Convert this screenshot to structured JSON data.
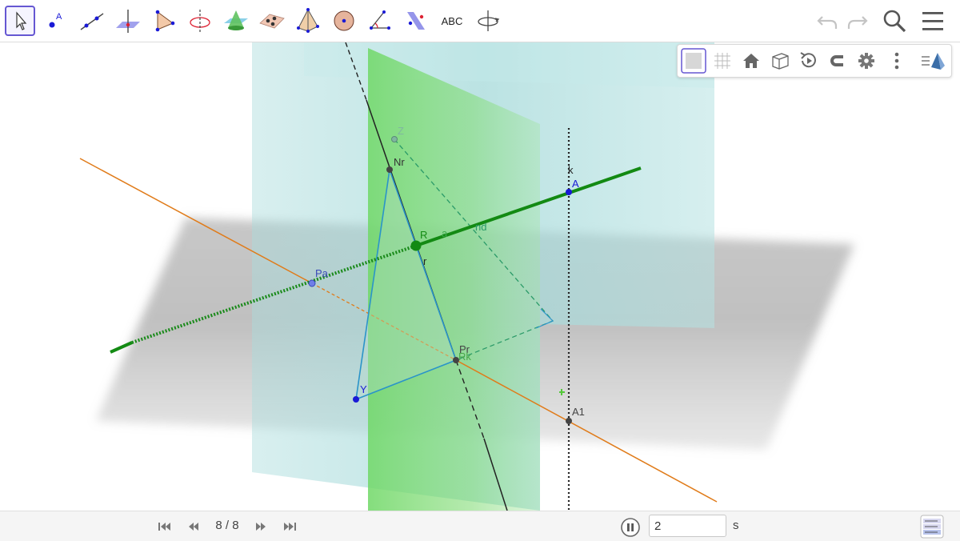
{
  "colors": {
    "toolbar_active_border": "#6557d2",
    "point_blue": "#1a1ad6",
    "line_orange": "#e07b19",
    "line_green": "#138a13",
    "plane_green": "#74d86a",
    "plane_cyan": "#a9dcdc",
    "plane_gray": "#9a9a9a",
    "triangle_blue": "#2a94c9"
  },
  "toolbar": {
    "tools": [
      {
        "name": "move-tool",
        "icon": "arrow-cursor-icon"
      },
      {
        "name": "point-tool",
        "icon": "point-icon"
      },
      {
        "name": "line-tool",
        "icon": "line-icon"
      },
      {
        "name": "perpendicular-line-tool",
        "icon": "perpendicular-line-icon"
      },
      {
        "name": "polygon-tool",
        "icon": "polygon-icon"
      },
      {
        "name": "circle-axis-tool",
        "icon": "circle-axis-icon"
      },
      {
        "name": "intersect-surfaces-tool",
        "icon": "intersect-surfaces-icon"
      },
      {
        "name": "plane-three-points-tool",
        "icon": "plane-three-points-icon"
      },
      {
        "name": "pyramid-tool",
        "icon": "pyramid-icon"
      },
      {
        "name": "sphere-tool",
        "icon": "sphere-icon"
      },
      {
        "name": "angle-tool",
        "icon": "angle-icon"
      },
      {
        "name": "reflect-plane-tool",
        "icon": "reflect-plane-icon"
      },
      {
        "name": "text-tool",
        "icon": "text-icon",
        "label": "ABC"
      },
      {
        "name": "rotate-view-tool",
        "icon": "rotate-view-icon"
      }
    ],
    "right": [
      "undo-icon",
      "redo-icon",
      "search-icon",
      "menu-icon"
    ]
  },
  "style_bar": {
    "buttons": [
      "plane-toggle-icon",
      "grid-icon",
      "home-icon",
      "cube-view-icon",
      "rotate-animation-icon",
      "point-capturing-icon",
      "settings-icon",
      "more-icon",
      "view-direction-icon"
    ]
  },
  "labels": {
    "Z": "Z",
    "Nr": "Nr",
    "k": "k",
    "A": "A",
    "R": "R",
    "a": "a",
    "nd": "nd",
    "r": "r",
    "Pa": "Pa",
    "Pr": "Pr",
    "Rk": "Rk",
    "Y": "Y",
    "A1": "A1"
  },
  "animation": {
    "step": "8 / 8",
    "speed": "2",
    "unit": "s",
    "nav_icons": [
      "first-step-icon",
      "previous-step-icon",
      "next-step-icon",
      "last-step-icon"
    ],
    "pause_icon": "pause-icon",
    "algebra_icon": "algebra-view-icon"
  }
}
